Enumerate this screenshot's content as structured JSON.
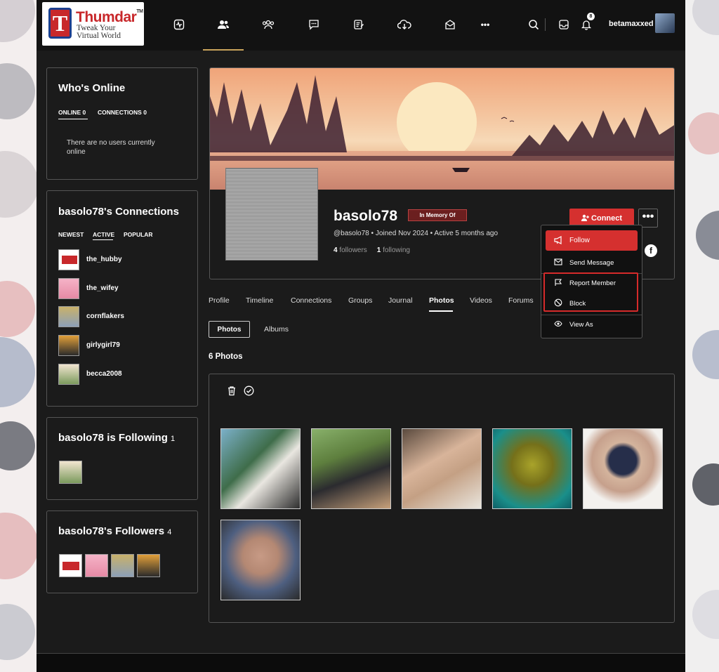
{
  "site": {
    "logo_letter": "T",
    "logo_name": "Thumdar",
    "logo_tm": "TM",
    "logo_tagline_1": "Tweak Your",
    "logo_tagline_2": "Virtual World"
  },
  "topbar": {
    "username": "betamaxxed",
    "notification_count": "8",
    "nav_icons": [
      "activity-icon",
      "members-icon",
      "groups-icon",
      "forums-icon",
      "journal-icon",
      "downloads-icon",
      "messages-icon",
      "more-icon"
    ]
  },
  "whos_online": {
    "title": "Who's Online",
    "tab_online": "ONLINE",
    "online_count": "0",
    "tab_connections": "CONNECTIONS",
    "connections_count": "0",
    "empty_text_1": "There are no users currently",
    "empty_text_2": "online"
  },
  "connections": {
    "title": "basolo78's Connections",
    "tabs": [
      "NEWEST",
      "ACTIVE",
      "POPULAR"
    ],
    "items": [
      {
        "name": "the_hubby"
      },
      {
        "name": "the_wifey"
      },
      {
        "name": "cornflakers"
      },
      {
        "name": "girlygirl79"
      },
      {
        "name": "becca2008"
      }
    ]
  },
  "following": {
    "title": "basolo78 is Following",
    "count": "1"
  },
  "followers": {
    "title": "basolo78's Followers",
    "count": "4"
  },
  "profile": {
    "name": "basolo78",
    "badge": "In Memory Of",
    "handle": "@basolo78",
    "joined": "Joined Nov 2024",
    "active": "Active 5 months ago",
    "bullet": "•",
    "followers_count": "4",
    "followers_label": "followers",
    "following_count": "1",
    "following_label": "following",
    "connect_label": "Connect",
    "more_label": "•••",
    "facebook_letter": "f"
  },
  "dropdown": {
    "follow": "Follow",
    "send_message": "Send Message",
    "report_member": "Report Member",
    "block": "Block",
    "view_as": "View As"
  },
  "profile_tabs": [
    "Profile",
    "Timeline",
    "Connections",
    "Groups",
    "Journal",
    "Photos",
    "Videos",
    "Forums"
  ],
  "active_tab": "Photos",
  "photo_subtabs": {
    "photos": "Photos",
    "albums": "Albums"
  },
  "photo_count_label": "6 Photos",
  "photos": [
    {
      "alt": "couple-by-waterfall"
    },
    {
      "alt": "couple-in-garden"
    },
    {
      "alt": "couple-closeup"
    },
    {
      "alt": "green-tinted-portrait"
    },
    {
      "alt": "man-in-beanie"
    },
    {
      "alt": "man-in-cap"
    }
  ]
}
